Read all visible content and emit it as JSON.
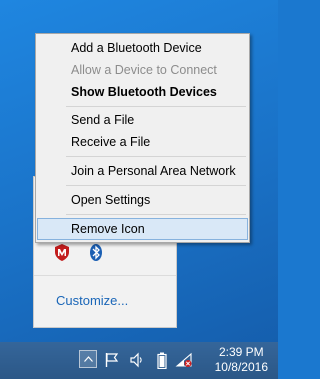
{
  "context_menu": {
    "items": [
      {
        "label": "Add a Bluetooth Device"
      },
      {
        "label": "Allow a Device to Connect"
      },
      {
        "label": "Show Bluetooth Devices"
      },
      {
        "label": "Send a File"
      },
      {
        "label": "Receive a File"
      },
      {
        "label": "Join a Personal Area Network"
      },
      {
        "label": "Open Settings"
      },
      {
        "label": "Remove Icon"
      }
    ]
  },
  "tray_flyout": {
    "icons": [
      "mcafee-shield-icon",
      "bluetooth-icon"
    ],
    "customize_label": "Customize..."
  },
  "taskbar": {
    "tray_icons": [
      "show-hidden-icons-icon",
      "action-center-flag-icon",
      "volume-icon",
      "battery-icon",
      "network-signal-icon"
    ],
    "clock": {
      "time": "2:39 PM",
      "date": "10/8/2016"
    }
  },
  "colors": {
    "desktop": "#1b78cf",
    "taskbar": "#2c5989",
    "menu_bg": "#f0f0f0",
    "menu_hover": "#d9e8f7",
    "link": "#1a66b8"
  }
}
